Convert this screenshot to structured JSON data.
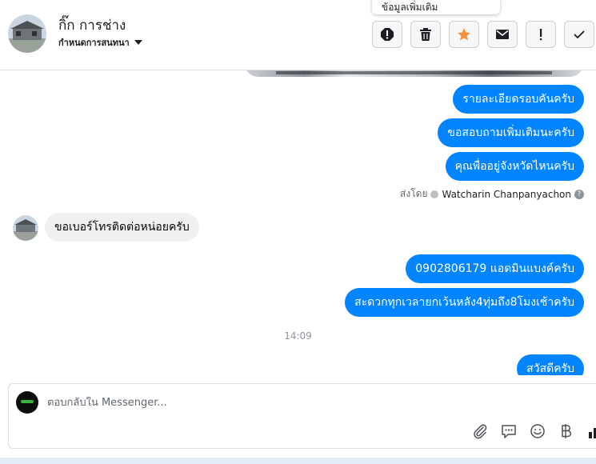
{
  "header": {
    "contact_name": "กิ๊ก การช่าง",
    "nickname_label": "กำหนดการสนทนา",
    "tooltip": "ข้อมูลเพิ่มเติม"
  },
  "messages": [
    {
      "direction": "outgoing",
      "text": "รายละเอียดรอบคันครับ"
    },
    {
      "direction": "outgoing",
      "text": "ขอสอบถามเพิ่มเติมนะครับ"
    },
    {
      "direction": "outgoing",
      "text": "คุณพื่ออยู่จังหวัดไหนครับ"
    },
    {
      "direction": "incoming",
      "text": "ขอเบอร์โทรติดต่อหน่อยครับ"
    },
    {
      "direction": "outgoing",
      "text": "0902806179 แอดมินแบงค์ครับ"
    },
    {
      "direction": "outgoing",
      "text": "สะดวกทุกเวลายกเว้นหลัง4ทุ่มถึง8โมงเช้าครับ"
    },
    {
      "direction": "outgoing",
      "text": "สวัสดีครับ"
    }
  ],
  "sent_by": {
    "prefix": "ส่งโดย",
    "sender": "Watcharin Chanpanyachon"
  },
  "timestamp": "14:09",
  "composer": {
    "placeholder": "ตอบกลับใน Messenger..."
  },
  "colors": {
    "accent": "#0084ff",
    "incoming_bubble": "#f1f0f0",
    "star": "#f7923b"
  },
  "icons": {
    "toolbar": [
      "alert-icon",
      "trash-icon",
      "star-icon",
      "envelope-icon",
      "exclamation-icon",
      "check-icon"
    ],
    "composer": [
      "paperclip-icon",
      "saved-reply-icon",
      "emoji-icon",
      "baht-icon",
      "chart-icon"
    ]
  }
}
